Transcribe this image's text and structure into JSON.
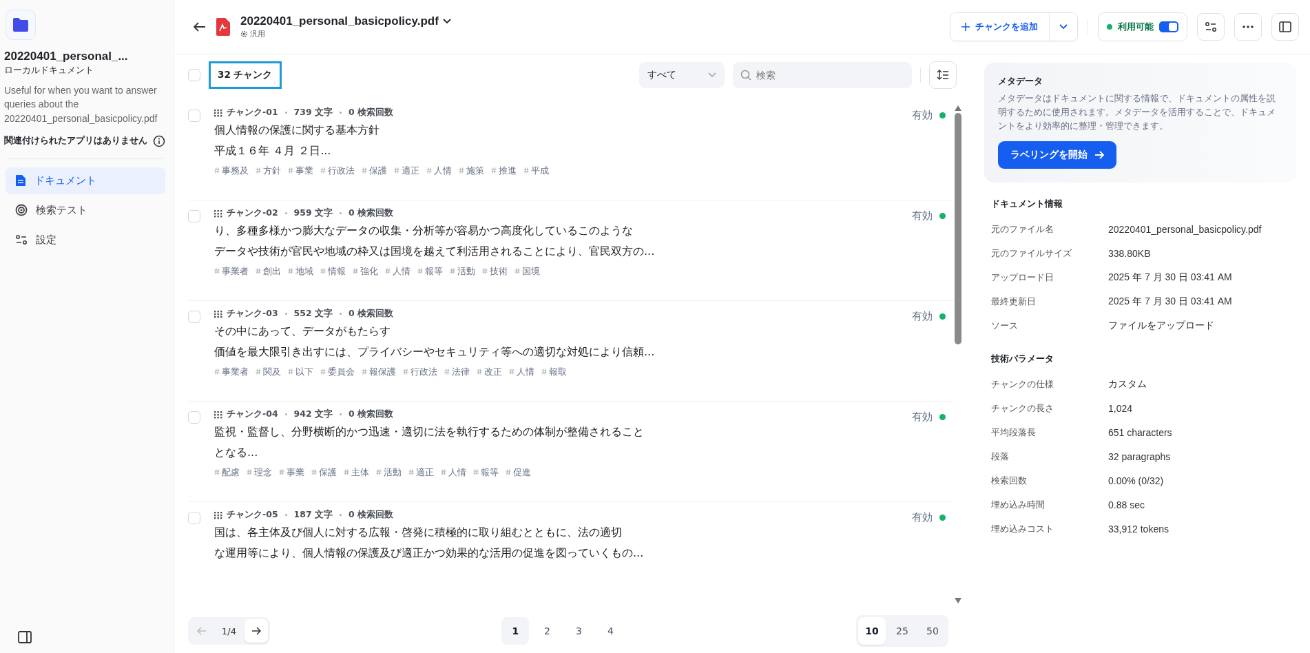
{
  "sidebar": {
    "title": "20220401_personal_...",
    "subtitle": "ローカルドキュメント",
    "description": "Useful for when you want to answer queries about the 20220401_personal_basicpolicy.pdf",
    "no_apps": "関連付けられたアプリはありません",
    "nav": [
      {
        "label": "ドキュメント",
        "kind": "document",
        "selected": true
      },
      {
        "label": "検索テスト",
        "kind": "target",
        "selected": false
      },
      {
        "label": "設定",
        "kind": "settings",
        "selected": false
      }
    ]
  },
  "header": {
    "filename": "20220401_personal_basicpolicy.pdf",
    "mode": "汎用",
    "add_button": "チャンクを追加",
    "status": {
      "label": "利用可能",
      "on": true
    }
  },
  "toolbar": {
    "select_all": false,
    "count": "32 チャンク",
    "filter": "すべて",
    "search_placeholder": "検索"
  },
  "chunks": [
    {
      "checked": false,
      "id": "チャンク-01",
      "chars": "739 文字",
      "hits": "0 検索回数",
      "status": "有効",
      "enabled": true,
      "lines": [
        "個人情報の保護に関する基本方針",
        "平成１６年 ４月 ２日..."
      ],
      "tags": [
        "事務及",
        "方針",
        "事業",
        "行政法",
        "保護",
        "適正",
        "人情",
        "施策",
        "推進",
        "平成"
      ]
    },
    {
      "checked": false,
      "id": "チャンク-02",
      "chars": "959 文字",
      "hits": "0 検索回数",
      "status": "有効",
      "enabled": true,
      "lines": [
        "り、多種多様かつ膨大なデータの収集・分析等が容易かつ高度化しているこのような",
        "データや技術が官民や地域の枠又は国境を越えて利活用されることにより、官民双方の..."
      ],
      "tags": [
        "事業者",
        "創出",
        "地域",
        "情報",
        "強化",
        "人情",
        "報等",
        "活動",
        "技術",
        "国境"
      ]
    },
    {
      "checked": false,
      "id": "チャンク-03",
      "chars": "552 文字",
      "hits": "0 検索回数",
      "status": "有効",
      "enabled": true,
      "lines": [
        "その中にあって、データがもたらす",
        "価値を最大限引き出すには、プライバシーやセキュリティ等への適切な対処により信頼..."
      ],
      "tags": [
        "事業者",
        "関及",
        "以下",
        "委員会",
        "報保護",
        "行政法",
        "法律",
        "改正",
        "人情",
        "報取"
      ]
    },
    {
      "checked": false,
      "id": "チャンク-04",
      "chars": "942 文字",
      "hits": "0 検索回数",
      "status": "有効",
      "enabled": true,
      "lines": [
        "監視・監督し、分野横断的かつ迅速・適切に法を執行するための体制が整備されること",
        "となる..."
      ],
      "tags": [
        "配慮",
        "理念",
        "事業",
        "保護",
        "主体",
        "活動",
        "適正",
        "人情",
        "報等",
        "促進"
      ]
    },
    {
      "checked": false,
      "id": "チャンク-05",
      "chars": "187 文字",
      "hits": "0 検索回数",
      "status": "有効",
      "enabled": true,
      "lines": [
        "国は、各主体及び個人に対する広報・啓発に積極的に取り組むとともに、法の適切",
        "な運用等により、個人情報の保護及び適正かつ効果的な活用の促進を図っていくもの..."
      ]
    }
  ],
  "pagination": {
    "current": "1/4",
    "pages": [
      {
        "label": "1",
        "selected": true
      },
      {
        "label": "2",
        "selected": false
      },
      {
        "label": "3",
        "selected": false
      },
      {
        "label": "4",
        "selected": false
      }
    ],
    "sizes": [
      {
        "label": "10",
        "selected": true
      },
      {
        "label": "25",
        "selected": false
      },
      {
        "label": "50",
        "selected": false
      }
    ]
  },
  "metadata": {
    "title": "メタデータ",
    "description": "メタデータはドキュメントに関する情報で、ドキュメントの属性を説明するために使用されます。メタデータを活用することで、ドキュメントをより効率的に整理・管理できます。",
    "button": "ラベリングを開始"
  },
  "sections": [
    {
      "title": "ドキュメント情報",
      "rows": [
        {
          "label": "元のファイル名",
          "value": "20220401_personal_basicpolicy.pdf"
        },
        {
          "label": "元のファイルサイズ",
          "value": "338.80KB"
        },
        {
          "label": "アップロード日",
          "value": "2025 年 7 月 30 日 03:41 AM"
        },
        {
          "label": "最終更新日",
          "value": "2025 年 7 月 30 日 03:41 AM"
        },
        {
          "label": "ソース",
          "value": "ファイルをアップロード"
        }
      ]
    },
    {
      "title": "技術パラメータ",
      "rows": [
        {
          "label": "チャンクの仕様",
          "value": "カスタム"
        },
        {
          "label": "チャンクの長さ",
          "value": "1,024"
        },
        {
          "label": "平均段落長",
          "value": "651 characters"
        },
        {
          "label": "段落",
          "value": "32 paragraphs"
        },
        {
          "label": "検索回数",
          "value": "0.00% (0/32)"
        },
        {
          "label": "埋め込み時間",
          "value": "0.88 sec"
        },
        {
          "label": "埋め込みコスト",
          "value": "33,912 tokens"
        }
      ]
    }
  ]
}
